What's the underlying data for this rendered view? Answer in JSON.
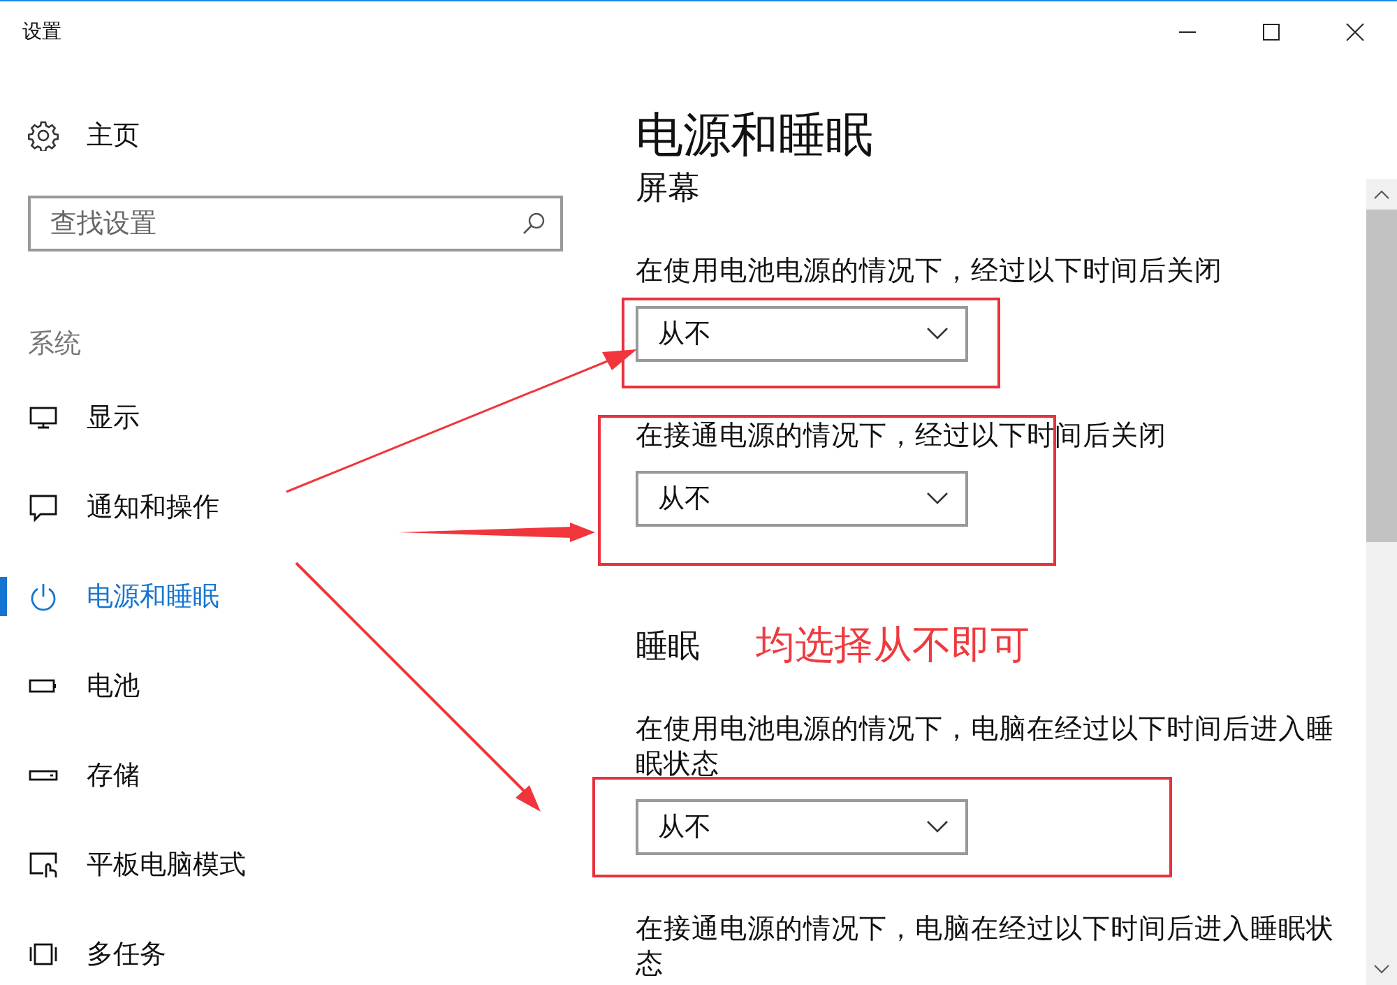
{
  "window": {
    "title": "设置"
  },
  "sidebar": {
    "home": "主页",
    "search": {
      "placeholder": "查找设置"
    },
    "section": "系统",
    "items": [
      {
        "label": "显示",
        "kind": "monitor",
        "selected": false
      },
      {
        "label": "通知和操作",
        "kind": "message",
        "selected": false
      },
      {
        "label": "电源和睡眠",
        "kind": "power",
        "selected": true
      },
      {
        "label": "电池",
        "kind": "battery",
        "selected": false
      },
      {
        "label": "存储",
        "kind": "drive",
        "selected": false
      },
      {
        "label": "平板电脑模式",
        "kind": "tablet",
        "selected": false
      },
      {
        "label": "多任务",
        "kind": "multitask",
        "selected": false
      }
    ]
  },
  "page": {
    "title": "电源和睡眠",
    "sections": [
      {
        "heading": "屏幕",
        "settings": [
          {
            "label": "在使用电池电源的情况下，经过以下时间后关闭",
            "value": "从不"
          },
          {
            "label": "在接通电源的情况下，经过以下时间后关闭",
            "value": "从不"
          }
        ]
      },
      {
        "heading": "睡眠",
        "annotation": "均选择从不即可",
        "settings": [
          {
            "label": "在使用电池电源的情况下，电脑在经过以下时间后进入睡眠状态",
            "value": "从不"
          },
          {
            "label": "在接通电源的情况下，电脑在经过以下时间后进入睡眠状态"
          }
        ]
      }
    ]
  }
}
